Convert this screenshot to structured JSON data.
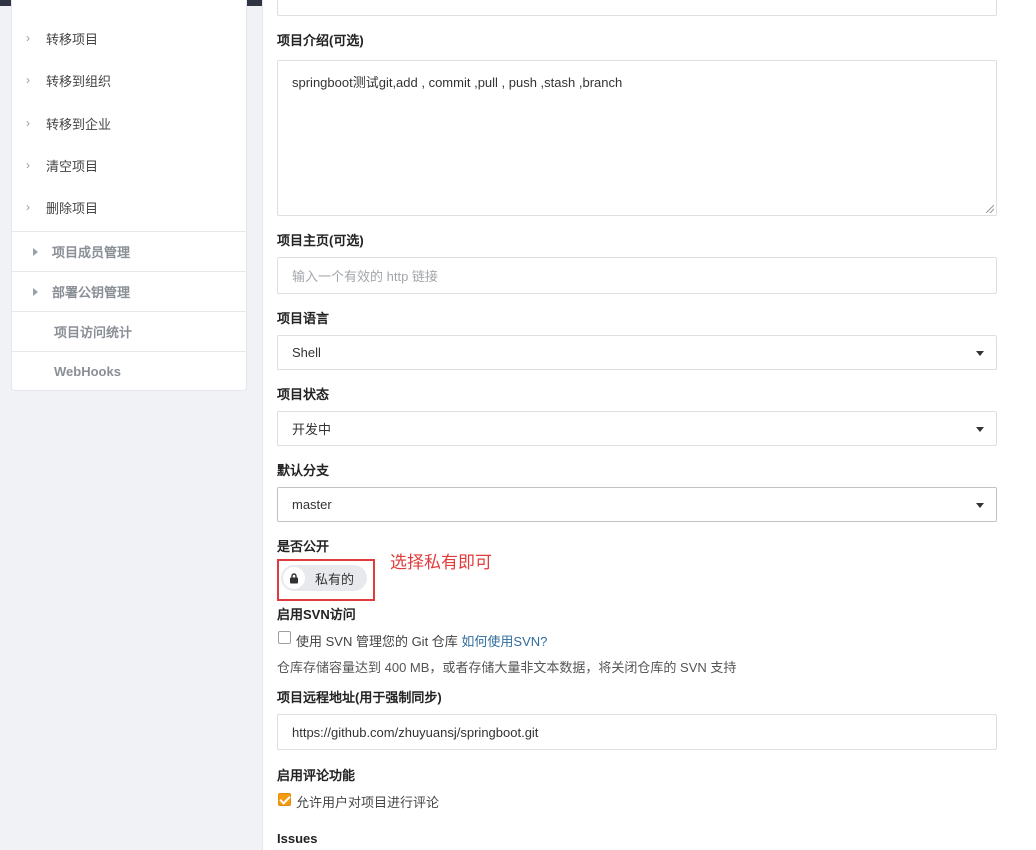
{
  "sidebar": {
    "sub_items": [
      "转移项目",
      "转移到组织",
      "转移到企业",
      "清空项目",
      "删除项目"
    ],
    "sections": [
      {
        "label": "项目成员管理",
        "expandable": true
      },
      {
        "label": "部署公钥管理",
        "expandable": true
      },
      {
        "label": "项目访问统计",
        "expandable": false
      },
      {
        "label": "WebHooks",
        "expandable": false
      }
    ]
  },
  "form": {
    "description": {
      "label": "项目介绍(可选)",
      "value": "springboot测试git,add , commit ,pull , push ,stash ,branch"
    },
    "homepage": {
      "label": "项目主页(可选)",
      "placeholder": "输入一个有效的 http 链接"
    },
    "language": {
      "label": "项目语言",
      "value": "Shell"
    },
    "status": {
      "label": "项目状态",
      "value": "开发中"
    },
    "default_branch": {
      "label": "默认分支",
      "value": "master"
    },
    "visibility": {
      "label": "是否公开",
      "value": "私有的"
    },
    "annotation": "选择私有即可",
    "svn": {
      "label": "启用SVN访问",
      "checkbox_text": "使用 SVN 管理您的 Git 仓库",
      "link": "如何使用SVN?",
      "note": "仓库存储容量达到 400 MB，或者存储大量非文本数据，将关闭仓库的 SVN 支持",
      "checked": false
    },
    "remote": {
      "label": "项目远程地址(用于强制同步)",
      "value": "https://github.com/zhuyuansj/springboot.git"
    },
    "comments": {
      "label": "启用评论功能",
      "checkbox_text": "允许用户对项目进行评论",
      "checked": true
    },
    "issues": {
      "label": "Issues"
    }
  },
  "colors": {
    "accent_red": "#e23b3b",
    "checkbox_on": "#f39c12",
    "link": "#2f6c9e"
  }
}
